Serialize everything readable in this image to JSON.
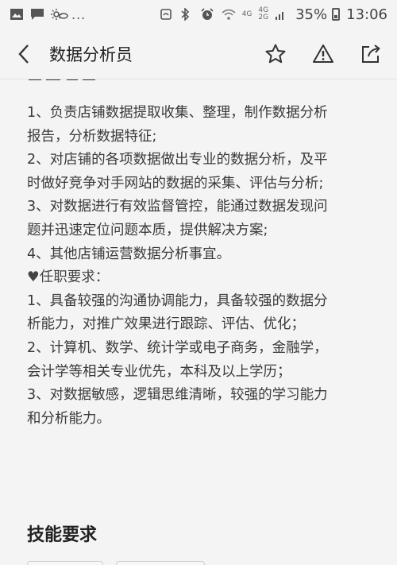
{
  "status_bar": {
    "left_icons": [
      "image-icon",
      "message-icon",
      "weather-icon"
    ],
    "dots": "...",
    "net_top": "4G",
    "net_right_top": "4G",
    "net_right_bottom": "2G",
    "battery_pct": "35%",
    "time": "13:06"
  },
  "header": {
    "title": "数据分析员"
  },
  "content": {
    "lines": [
      "1、负责店铺数据提取收集、整理，制作数据分析",
      "报告，分析数据特征;",
      "2、对店铺的各项数据做出专业的数据分析，及平",
      "时做好竞争对手网站的数据的采集、评估与分析;",
      "3、对数据进行有效监督管控，能通过数据发现问",
      "题并迅速定位问题本质，提供解决方案;",
      "4、其他店铺运营数据分析事宜。",
      "♥任职要求：",
      "1、具备较强的沟通协调能力，具备较强的数据分",
      "析能力，对推广效果进行跟踪、评估、优化；",
      "2、计算机、数学、统计学或电子商务，金融学，",
      "会计学等相关专业优先，本科及以上学历；",
      "3、对数据敏感，逻辑思维清晰，较强的学习能力",
      "和分析能力。"
    ],
    "section_title": "技能要求"
  },
  "colors": {
    "background": "#f4f4f4",
    "text": "#3a3a3a"
  }
}
